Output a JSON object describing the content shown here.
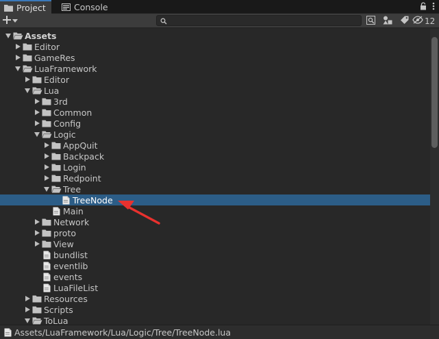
{
  "tabs": [
    {
      "label": "Project",
      "icon": "folder-icon",
      "active": true
    },
    {
      "label": "Console",
      "icon": "console-icon",
      "active": false
    }
  ],
  "toolbar": {
    "create_label": "+",
    "search_placeholder": "",
    "hidden_count": "12"
  },
  "tree": [
    {
      "label": "Assets",
      "depth": 0,
      "type": "folder",
      "expanded": true,
      "bold": true
    },
    {
      "label": "Editor",
      "depth": 1,
      "type": "folder",
      "expanded": false
    },
    {
      "label": "GameRes",
      "depth": 1,
      "type": "folder",
      "expanded": false
    },
    {
      "label": "LuaFramework",
      "depth": 1,
      "type": "folder",
      "expanded": true
    },
    {
      "label": "Editor",
      "depth": 2,
      "type": "folder",
      "expanded": false
    },
    {
      "label": "Lua",
      "depth": 2,
      "type": "folder",
      "expanded": true
    },
    {
      "label": "3rd",
      "depth": 3,
      "type": "folder",
      "expanded": false
    },
    {
      "label": "Common",
      "depth": 3,
      "type": "folder",
      "expanded": false
    },
    {
      "label": "Config",
      "depth": 3,
      "type": "folder",
      "expanded": false
    },
    {
      "label": "Logic",
      "depth": 3,
      "type": "folder",
      "expanded": true
    },
    {
      "label": "AppQuit",
      "depth": 4,
      "type": "folder",
      "expanded": false
    },
    {
      "label": "Backpack",
      "depth": 4,
      "type": "folder",
      "expanded": false
    },
    {
      "label": "Login",
      "depth": 4,
      "type": "folder",
      "expanded": false
    },
    {
      "label": "Redpoint",
      "depth": 4,
      "type": "folder",
      "expanded": false
    },
    {
      "label": "Tree",
      "depth": 4,
      "type": "folder",
      "expanded": true
    },
    {
      "label": "TreeNode",
      "depth": 5,
      "type": "file",
      "selected": true
    },
    {
      "label": "Main",
      "depth": 4,
      "type": "file"
    },
    {
      "label": "Network",
      "depth": 3,
      "type": "folder",
      "expanded": false
    },
    {
      "label": "proto",
      "depth": 3,
      "type": "folder",
      "expanded": false
    },
    {
      "label": "View",
      "depth": 3,
      "type": "folder",
      "expanded": false
    },
    {
      "label": "bundlist",
      "depth": 3,
      "type": "file"
    },
    {
      "label": "eventlib",
      "depth": 3,
      "type": "file"
    },
    {
      "label": "events",
      "depth": 3,
      "type": "file"
    },
    {
      "label": "LuaFileList",
      "depth": 3,
      "type": "file"
    },
    {
      "label": "Resources",
      "depth": 2,
      "type": "folder",
      "expanded": false
    },
    {
      "label": "Scripts",
      "depth": 2,
      "type": "folder",
      "expanded": false
    },
    {
      "label": "ToLua",
      "depth": 2,
      "type": "folder",
      "expanded": true
    }
  ],
  "status": {
    "path": "Assets/LuaFramework/Lua/Logic/Tree/TreeNode.lua"
  },
  "colors": {
    "background": "#282828",
    "selection": "#2c5d87",
    "annotation_arrow": "#e8312e",
    "folder": "#c2c2c2",
    "file": "#e6e6e6"
  }
}
